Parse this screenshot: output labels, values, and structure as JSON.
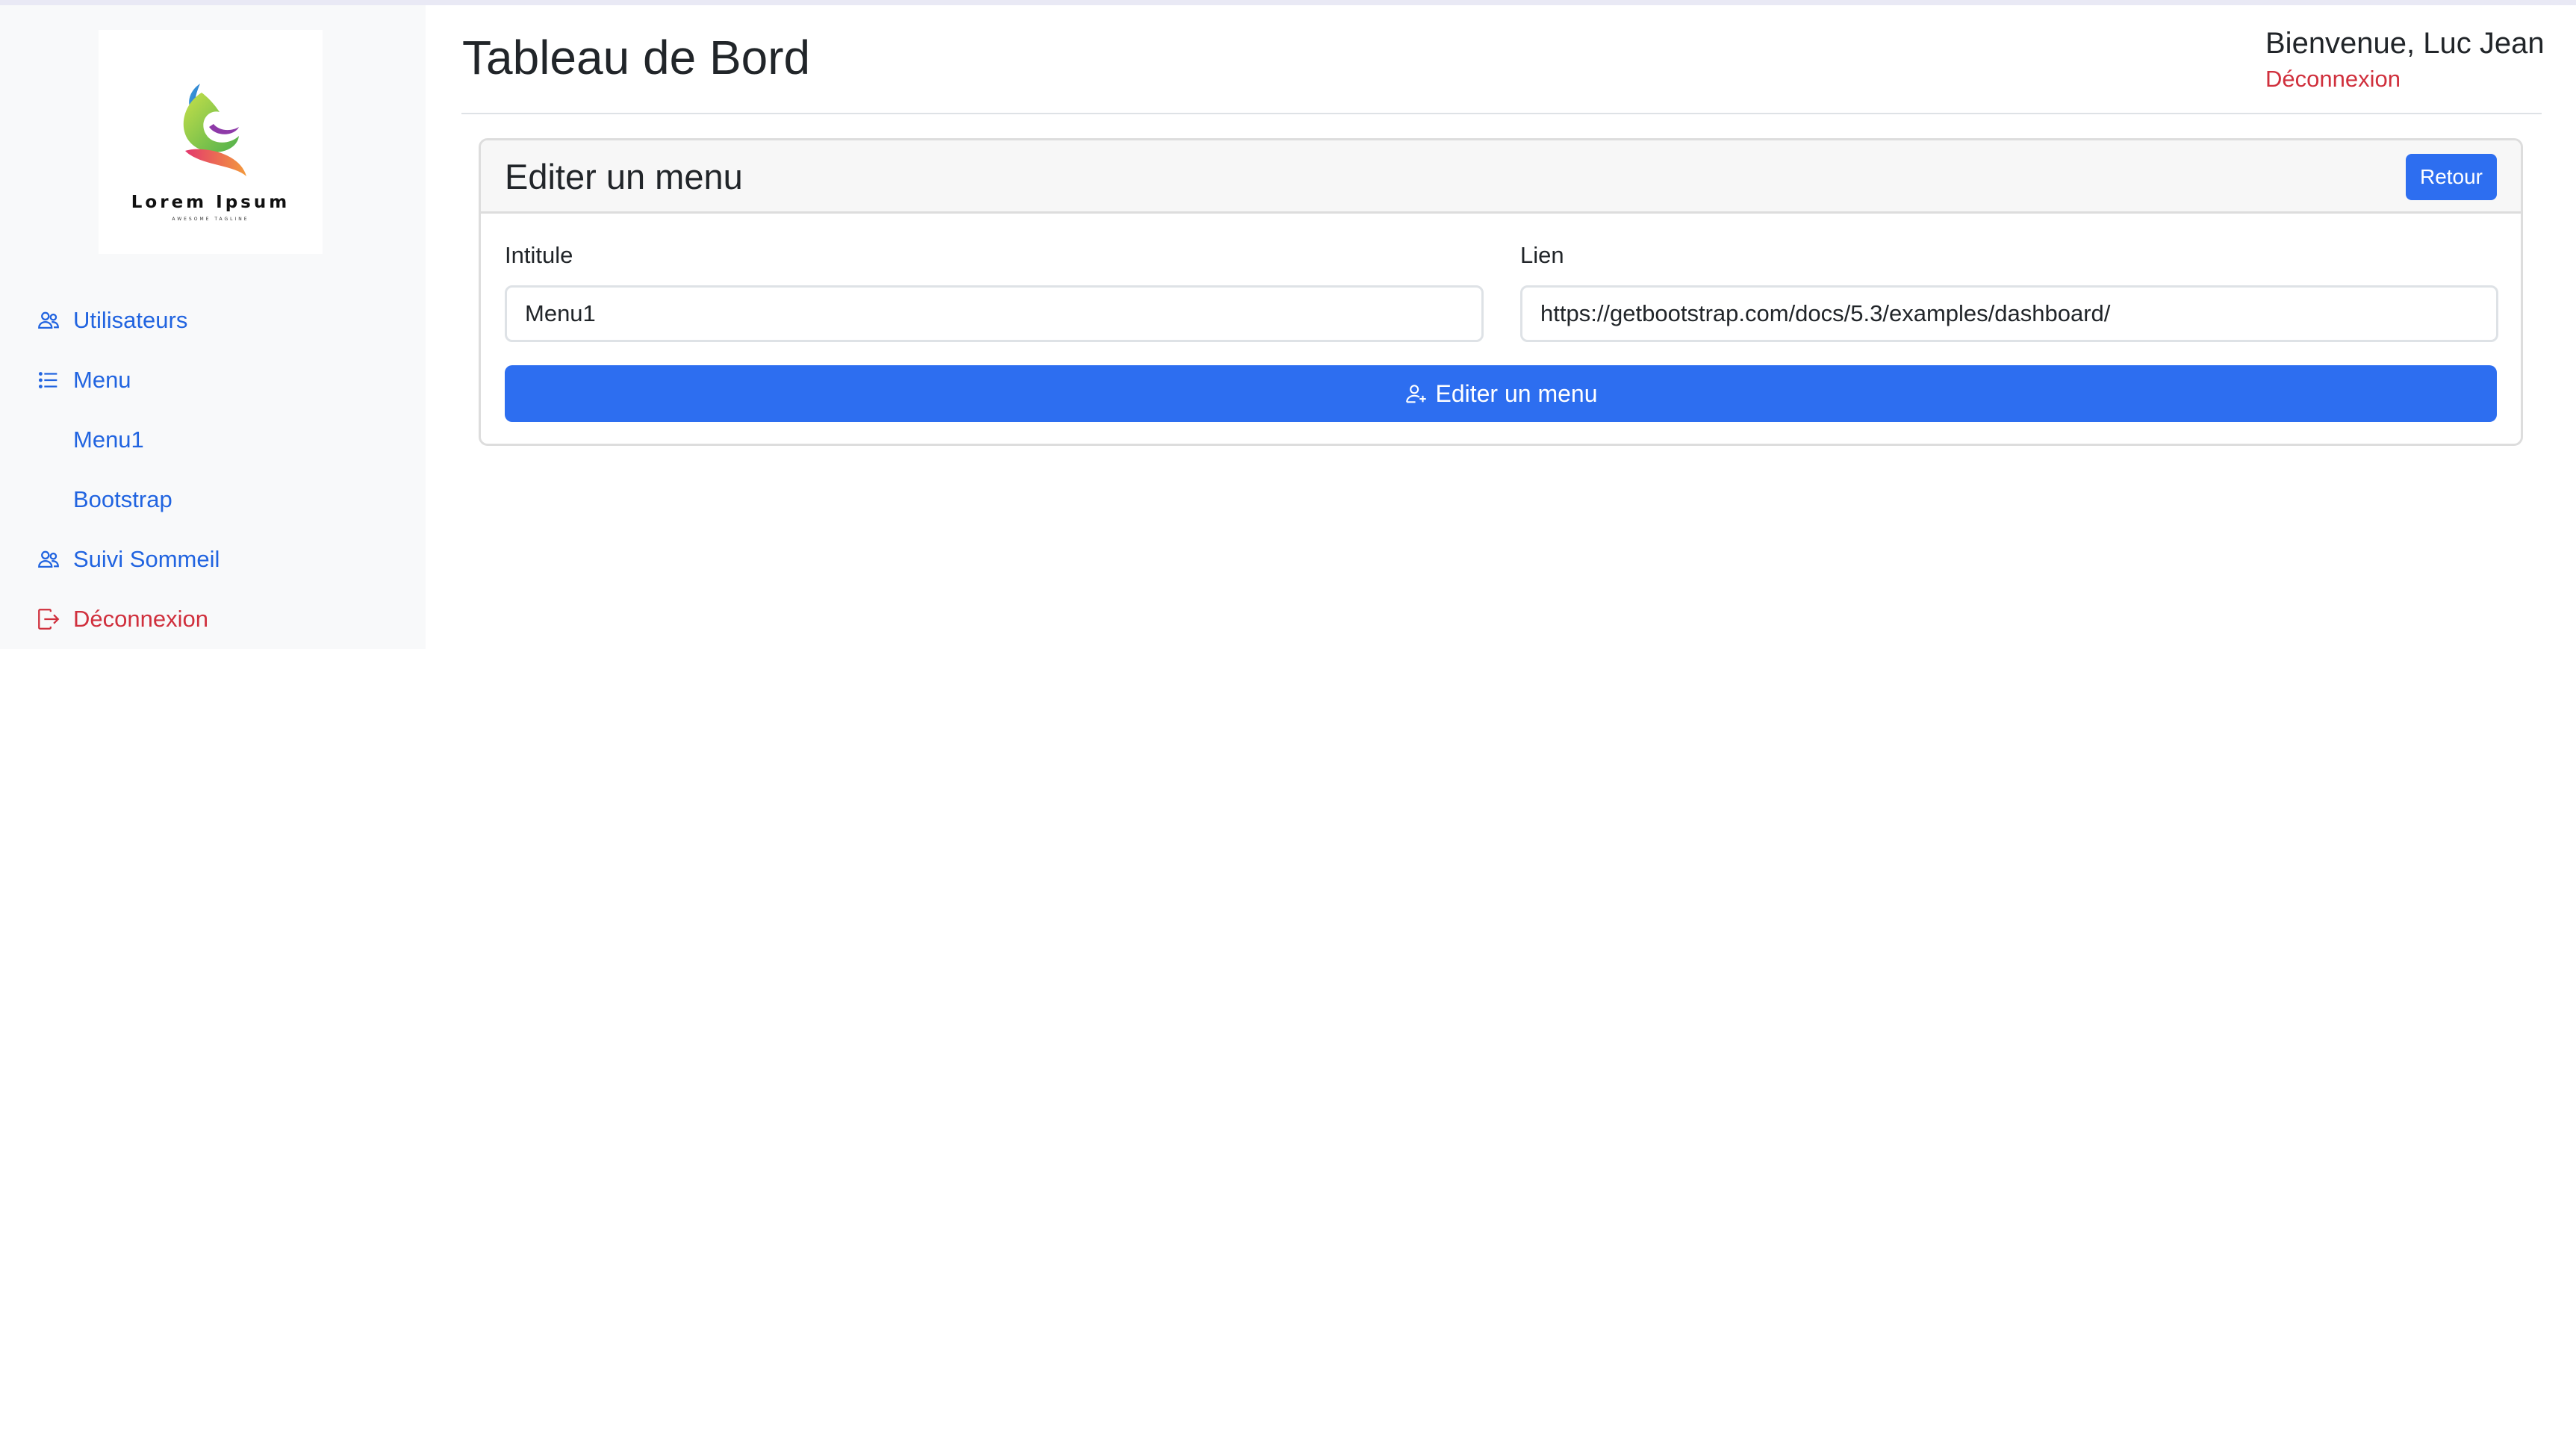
{
  "brand": {
    "name": "Lorem Ipsum",
    "tagline": "AWESOME TAGLINE"
  },
  "sidebar": {
    "items": [
      {
        "label": "Utilisateurs",
        "icon": "users-icon"
      },
      {
        "label": "Menu",
        "icon": "list-icon"
      },
      {
        "label": "Menu1"
      },
      {
        "label": "Bootstrap"
      },
      {
        "label": "Suivi Sommeil",
        "icon": "users-icon"
      },
      {
        "label": "Déconnexion",
        "icon": "logout-icon"
      }
    ]
  },
  "header": {
    "title": "Tableau de Bord",
    "welcome": "Bienvenue, Luc Jean",
    "logout": "Déconnexion"
  },
  "card": {
    "title": "Editer un menu",
    "back_label": "Retour",
    "fields": {
      "intitule": {
        "label": "Intitule",
        "value": "Menu1"
      },
      "lien": {
        "label": "Lien",
        "value": "https://getbootstrap.com/docs/5.3/examples/dashboard/"
      }
    },
    "submit_label": "Editer un menu",
    "submit_icon": "person-add-icon"
  },
  "colors": {
    "primary": "#2d6ef0",
    "link": "#2164e0",
    "danger": "#d0303d",
    "sidebar_bg": "#f8f9fa"
  }
}
